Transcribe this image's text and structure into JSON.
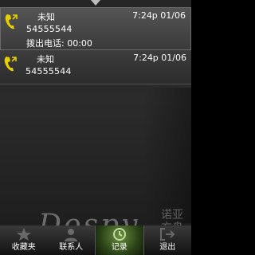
{
  "calls": [
    {
      "name": "未知",
      "time": "7:24p 01/06",
      "number": "54555544",
      "detail": "拨出电话: 00:00",
      "icon": "phone-outgoing-icon"
    },
    {
      "name": "未知",
      "time": "7:24p 01/06",
      "number": "54555544",
      "icon": "phone-outgoing-icon"
    }
  ],
  "tabs": [
    {
      "label": "收藏夹",
      "icon": "star-icon"
    },
    {
      "label": "联系人",
      "icon": "contacts-icon"
    },
    {
      "label": "记录",
      "icon": "call-log-icon",
      "active": true
    },
    {
      "label": "退出",
      "icon": "exit-icon"
    }
  ],
  "watermark": {
    "text": "Dospy",
    "cn": "诺亚方舟"
  },
  "colors": {
    "icon": "#e8d000",
    "active_tab": "#4c6e2a"
  }
}
